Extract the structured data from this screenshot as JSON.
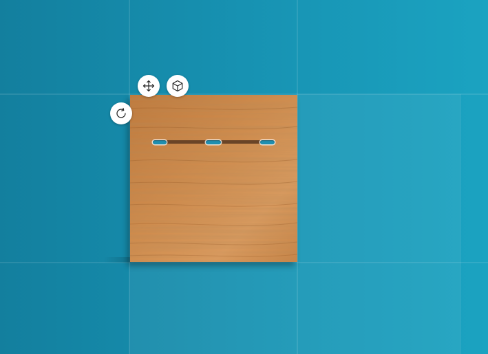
{
  "scene": {
    "background_colors": [
      "#137f9e",
      "#1792b2",
      "#1ba3c1"
    ],
    "panel_wood_colors": [
      "#c98547",
      "#d79457",
      "#b87438"
    ],
    "slot_color": "#1f8fb0",
    "rail_color": "#6a4427"
  },
  "controls": {
    "move": {
      "icon": "move-icon"
    },
    "view_3d": {
      "icon": "cube-icon"
    },
    "rotate": {
      "icon": "rotate-icon"
    }
  }
}
